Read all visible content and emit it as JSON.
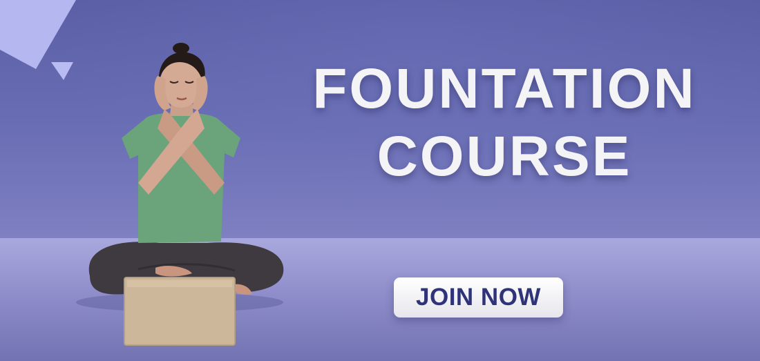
{
  "banner": {
    "title_line1": "FOUNTATION",
    "title_line2": "COURSE",
    "cta_label": "JOIN NOW"
  },
  "colors": {
    "background": "#6567ad",
    "floor": "#9e9dd6",
    "title_text": "#f4f4f6",
    "button_bg": "#ffffff",
    "button_text": "#2f3478",
    "accent_triangle": "#b9bcf3"
  }
}
